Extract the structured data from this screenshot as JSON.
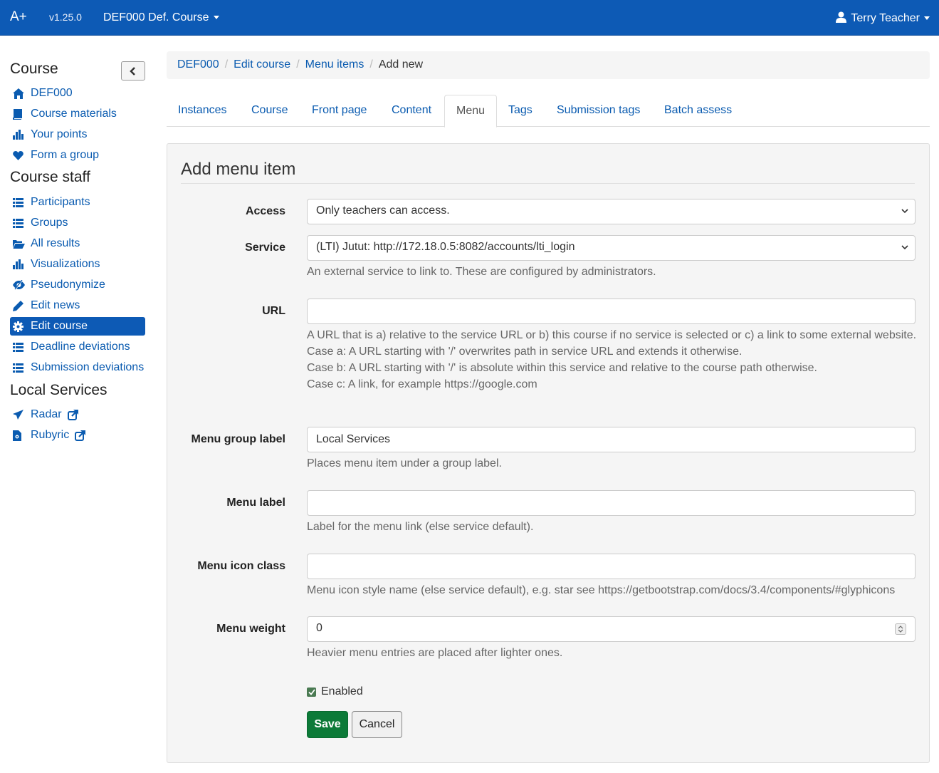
{
  "navbar": {
    "brand": "A+",
    "version": "v1.25.0",
    "course": "DEF000 Def. Course",
    "user": "Terry Teacher"
  },
  "sidebar": {
    "course_heading": "Course",
    "course_items": [
      {
        "label": "DEF000",
        "icon": "home-icon"
      },
      {
        "label": "Course materials",
        "icon": "book-icon"
      },
      {
        "label": "Your points",
        "icon": "stats-icon"
      },
      {
        "label": "Form a group",
        "icon": "heart-icon"
      }
    ],
    "staff_heading": "Course staff",
    "staff_items": [
      {
        "label": "Participants",
        "icon": "list-icon"
      },
      {
        "label": "Groups",
        "icon": "list-icon"
      },
      {
        "label": "All results",
        "icon": "folder-open-icon"
      },
      {
        "label": "Visualizations",
        "icon": "stats-icon"
      },
      {
        "label": "Pseudonymize",
        "icon": "eye-slash-icon"
      },
      {
        "label": "Edit news",
        "icon": "pencil-icon"
      },
      {
        "label": "Edit course",
        "icon": "cog-icon"
      },
      {
        "label": "Deadline deviations",
        "icon": "list-icon"
      },
      {
        "label": "Submission deviations",
        "icon": "list-icon"
      }
    ],
    "local_heading": "Local Services",
    "local_items": [
      {
        "label": "Radar",
        "icon": "send-icon"
      },
      {
        "label": "Rubyric",
        "icon": "file-icon"
      }
    ]
  },
  "breadcrumb": [
    "DEF000",
    "Edit course",
    "Menu items",
    "Add new"
  ],
  "tabs": [
    "Instances",
    "Course",
    "Front page",
    "Content",
    "Menu",
    "Tags",
    "Submission tags",
    "Batch assess"
  ],
  "form": {
    "title": "Add menu item",
    "access": {
      "label": "Access",
      "value": "Only teachers can access."
    },
    "service": {
      "label": "Service",
      "value": "(LTI) Jutut: http://172.18.0.5:8082/accounts/lti_login",
      "help": "An external service to link to. These are configured by administrators."
    },
    "url": {
      "label": "URL",
      "value": "",
      "help": [
        "A URL that is a) relative to the service URL or b) this course if no service is selected or c) a link to some external website.",
        "Case a: A URL starting with '/' overwrites path in service URL and extends it otherwise.",
        "Case b: A URL starting with '/' is absolute within this service and relative to the course path otherwise.",
        "Case c: A link, for example https://google.com"
      ]
    },
    "group_label": {
      "label": "Menu group label",
      "value": "Local Services",
      "help": "Places menu item under a group label."
    },
    "menu_label": {
      "label": "Menu label",
      "value": "",
      "help": "Label for the menu link (else service default)."
    },
    "icon_class": {
      "label": "Menu icon class",
      "value": "",
      "help": "Menu icon style name (else service default), e.g. star see https://getbootstrap.com/docs/3.4/components/#glyphicons"
    },
    "weight": {
      "label": "Menu weight",
      "value": "0",
      "help": "Heavier menu entries are placed after lighter ones."
    },
    "enabled": {
      "label": "Enabled",
      "checked": true
    },
    "save_label": "Save",
    "cancel_label": "Cancel"
  },
  "colors": {
    "navbar": "#0d5ab5",
    "link": "#0a5bb0",
    "save": "#0c7a38"
  }
}
